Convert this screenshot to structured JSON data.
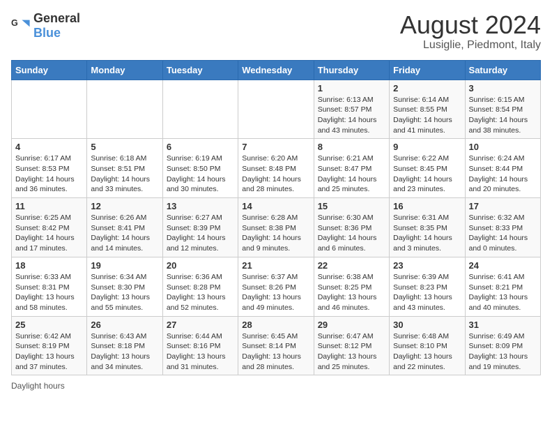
{
  "header": {
    "logo_general": "General",
    "logo_blue": "Blue",
    "title": "August 2024",
    "subtitle": "Lusiglie, Piedmont, Italy"
  },
  "weekdays": [
    "Sunday",
    "Monday",
    "Tuesday",
    "Wednesday",
    "Thursday",
    "Friday",
    "Saturday"
  ],
  "weeks": [
    [
      {
        "day": "",
        "info": ""
      },
      {
        "day": "",
        "info": ""
      },
      {
        "day": "",
        "info": ""
      },
      {
        "day": "",
        "info": ""
      },
      {
        "day": "1",
        "info": "Sunrise: 6:13 AM\nSunset: 8:57 PM\nDaylight: 14 hours and 43 minutes."
      },
      {
        "day": "2",
        "info": "Sunrise: 6:14 AM\nSunset: 8:55 PM\nDaylight: 14 hours and 41 minutes."
      },
      {
        "day": "3",
        "info": "Sunrise: 6:15 AM\nSunset: 8:54 PM\nDaylight: 14 hours and 38 minutes."
      }
    ],
    [
      {
        "day": "4",
        "info": "Sunrise: 6:17 AM\nSunset: 8:53 PM\nDaylight: 14 hours and 36 minutes."
      },
      {
        "day": "5",
        "info": "Sunrise: 6:18 AM\nSunset: 8:51 PM\nDaylight: 14 hours and 33 minutes."
      },
      {
        "day": "6",
        "info": "Sunrise: 6:19 AM\nSunset: 8:50 PM\nDaylight: 14 hours and 30 minutes."
      },
      {
        "day": "7",
        "info": "Sunrise: 6:20 AM\nSunset: 8:48 PM\nDaylight: 14 hours and 28 minutes."
      },
      {
        "day": "8",
        "info": "Sunrise: 6:21 AM\nSunset: 8:47 PM\nDaylight: 14 hours and 25 minutes."
      },
      {
        "day": "9",
        "info": "Sunrise: 6:22 AM\nSunset: 8:45 PM\nDaylight: 14 hours and 23 minutes."
      },
      {
        "day": "10",
        "info": "Sunrise: 6:24 AM\nSunset: 8:44 PM\nDaylight: 14 hours and 20 minutes."
      }
    ],
    [
      {
        "day": "11",
        "info": "Sunrise: 6:25 AM\nSunset: 8:42 PM\nDaylight: 14 hours and 17 minutes."
      },
      {
        "day": "12",
        "info": "Sunrise: 6:26 AM\nSunset: 8:41 PM\nDaylight: 14 hours and 14 minutes."
      },
      {
        "day": "13",
        "info": "Sunrise: 6:27 AM\nSunset: 8:39 PM\nDaylight: 14 hours and 12 minutes."
      },
      {
        "day": "14",
        "info": "Sunrise: 6:28 AM\nSunset: 8:38 PM\nDaylight: 14 hours and 9 minutes."
      },
      {
        "day": "15",
        "info": "Sunrise: 6:30 AM\nSunset: 8:36 PM\nDaylight: 14 hours and 6 minutes."
      },
      {
        "day": "16",
        "info": "Sunrise: 6:31 AM\nSunset: 8:35 PM\nDaylight: 14 hours and 3 minutes."
      },
      {
        "day": "17",
        "info": "Sunrise: 6:32 AM\nSunset: 8:33 PM\nDaylight: 14 hours and 0 minutes."
      }
    ],
    [
      {
        "day": "18",
        "info": "Sunrise: 6:33 AM\nSunset: 8:31 PM\nDaylight: 13 hours and 58 minutes."
      },
      {
        "day": "19",
        "info": "Sunrise: 6:34 AM\nSunset: 8:30 PM\nDaylight: 13 hours and 55 minutes."
      },
      {
        "day": "20",
        "info": "Sunrise: 6:36 AM\nSunset: 8:28 PM\nDaylight: 13 hours and 52 minutes."
      },
      {
        "day": "21",
        "info": "Sunrise: 6:37 AM\nSunset: 8:26 PM\nDaylight: 13 hours and 49 minutes."
      },
      {
        "day": "22",
        "info": "Sunrise: 6:38 AM\nSunset: 8:25 PM\nDaylight: 13 hours and 46 minutes."
      },
      {
        "day": "23",
        "info": "Sunrise: 6:39 AM\nSunset: 8:23 PM\nDaylight: 13 hours and 43 minutes."
      },
      {
        "day": "24",
        "info": "Sunrise: 6:41 AM\nSunset: 8:21 PM\nDaylight: 13 hours and 40 minutes."
      }
    ],
    [
      {
        "day": "25",
        "info": "Sunrise: 6:42 AM\nSunset: 8:19 PM\nDaylight: 13 hours and 37 minutes."
      },
      {
        "day": "26",
        "info": "Sunrise: 6:43 AM\nSunset: 8:18 PM\nDaylight: 13 hours and 34 minutes."
      },
      {
        "day": "27",
        "info": "Sunrise: 6:44 AM\nSunset: 8:16 PM\nDaylight: 13 hours and 31 minutes."
      },
      {
        "day": "28",
        "info": "Sunrise: 6:45 AM\nSunset: 8:14 PM\nDaylight: 13 hours and 28 minutes."
      },
      {
        "day": "29",
        "info": "Sunrise: 6:47 AM\nSunset: 8:12 PM\nDaylight: 13 hours and 25 minutes."
      },
      {
        "day": "30",
        "info": "Sunrise: 6:48 AM\nSunset: 8:10 PM\nDaylight: 13 hours and 22 minutes."
      },
      {
        "day": "31",
        "info": "Sunrise: 6:49 AM\nSunset: 8:09 PM\nDaylight: 13 hours and 19 minutes."
      }
    ]
  ],
  "legend": "Daylight hours"
}
